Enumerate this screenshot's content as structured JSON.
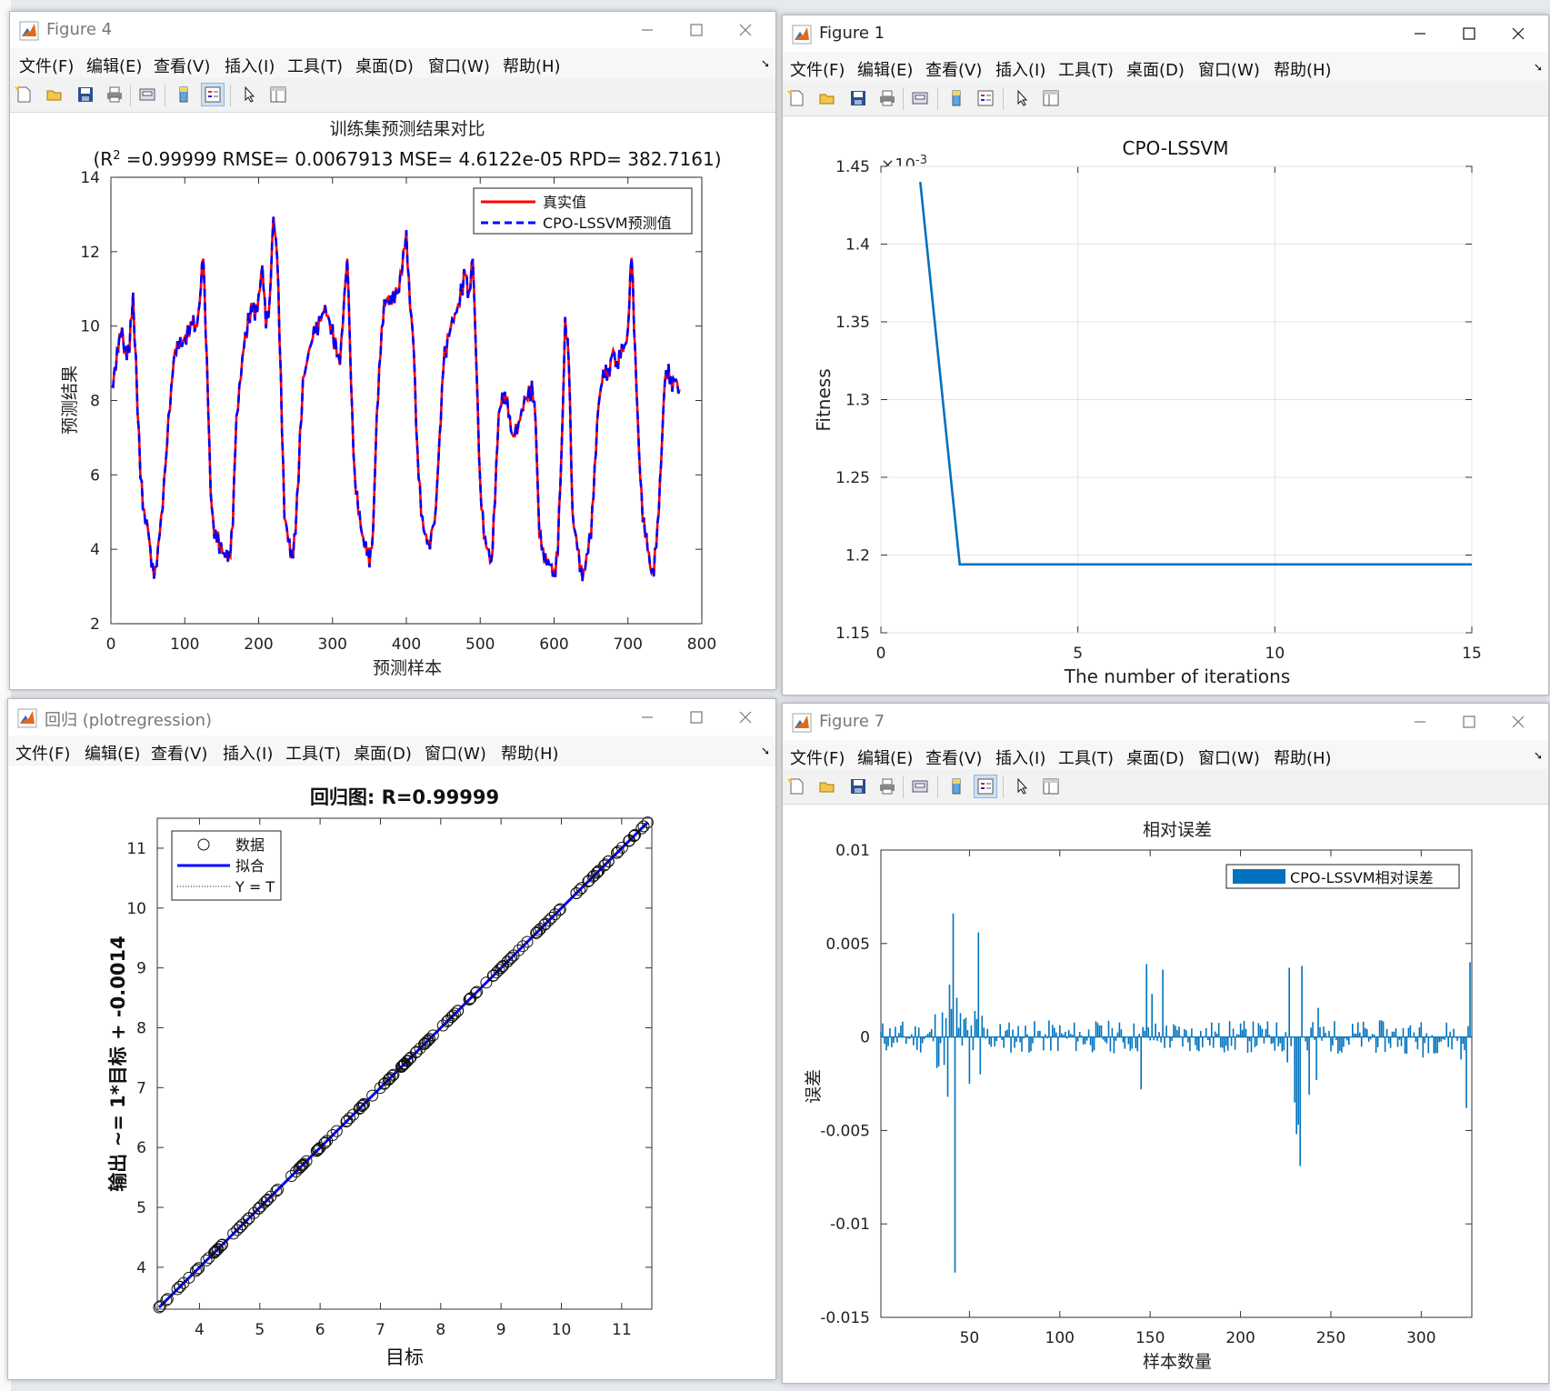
{
  "menu": [
    "文件(F)",
    "编辑(E)",
    "查看(V)",
    "插入(I)",
    "工具(T)",
    "桌面(D)",
    "窗口(W)",
    "帮助(H)"
  ],
  "windows": {
    "fig4": {
      "title": "Figure 4"
    },
    "fig1": {
      "title": "Figure 1"
    },
    "reg": {
      "title": "回归 (plotregression)"
    },
    "fig7": {
      "title": "Figure 7"
    }
  },
  "colors": {
    "true_line": "#ff0000",
    "pred_line": "#0000ff",
    "fitness_line": "#0072bd",
    "error_bars": "#0072bd",
    "fit_line": "#0000ff"
  },
  "chart_data": [
    {
      "id": "pred",
      "type": "line",
      "title": "训练集预测结果对比",
      "subtitle_prefix": "(R",
      "subtitle_sup": "2",
      "subtitle_rest": " =0.99999 RMSE= 0.0067913 MSE= 4.6122e-05 RPD= 382.7161)",
      "xlabel": "预测样本",
      "ylabel": "预测结果",
      "xlim": [
        0,
        800
      ],
      "ylim": [
        2,
        14
      ],
      "xticks": [
        0,
        100,
        200,
        300,
        400,
        500,
        600,
        700,
        800
      ],
      "yticks": [
        2,
        4,
        6,
        8,
        10,
        12,
        14
      ],
      "grid": false,
      "legend_position": "top-right",
      "series": [
        {
          "name": "真实值",
          "style": "solid"
        },
        {
          "name": "CPO-LSSVM预测值",
          "style": "dashed"
        }
      ],
      "x": [
        1,
        5,
        10,
        15,
        18,
        25,
        30,
        40,
        45,
        50,
        55,
        60,
        70,
        80,
        85,
        90,
        100,
        110,
        115,
        120,
        125,
        130,
        135,
        140,
        145,
        155,
        160,
        165,
        170,
        180,
        190,
        195,
        200,
        205,
        210,
        215,
        220,
        225,
        230,
        235,
        240,
        245,
        250,
        260,
        270,
        275,
        280,
        290,
        300,
        310,
        320,
        325,
        330,
        335,
        340,
        345,
        350,
        355,
        360,
        365,
        370,
        375,
        380,
        390,
        400,
        405,
        410,
        415,
        420,
        425,
        430,
        440,
        445,
        450,
        460,
        470,
        480,
        485,
        490,
        495,
        500,
        505,
        510,
        515,
        520,
        525,
        530,
        535,
        540,
        545,
        550,
        560,
        570,
        575,
        580,
        585,
        590,
        595,
        600,
        605,
        610,
        615,
        620,
        625,
        630,
        635,
        640,
        650,
        655,
        660,
        665,
        670,
        675,
        680,
        685,
        690,
        695,
        700,
        705,
        710,
        715,
        720,
        725,
        730,
        735,
        740,
        745,
        750,
        755,
        760,
        765,
        770
      ],
      "values": [
        8.3,
        8.7,
        9.6,
        9.8,
        9.3,
        9.4,
        10.8,
        6.0,
        5.0,
        4.5,
        3.7,
        3.3,
        5.2,
        8.0,
        9.0,
        9.5,
        9.6,
        10.1,
        10.0,
        10.5,
        12.0,
        9.0,
        5.5,
        4.5,
        4.2,
        3.8,
        3.7,
        4.8,
        7.5,
        9.5,
        10.5,
        10.3,
        10.8,
        11.5,
        10.2,
        10.5,
        13.0,
        12.0,
        8.5,
        5.0,
        4.2,
        3.8,
        4.5,
        8.5,
        9.5,
        9.8,
        10.0,
        10.5,
        9.8,
        9.0,
        11.9,
        8.5,
        6.0,
        5.0,
        4.5,
        4.0,
        3.7,
        4.5,
        7.5,
        9.5,
        10.5,
        10.8,
        10.7,
        11.0,
        12.5,
        10.5,
        9.5,
        6.5,
        5.0,
        4.5,
        4.0,
        5.0,
        7.0,
        9.0,
        10.0,
        10.5,
        11.5,
        10.8,
        11.8,
        9.0,
        5.5,
        4.5,
        4.0,
        3.5,
        5.5,
        7.5,
        8.2,
        8.0,
        7.5,
        7.0,
        7.2,
        8.0,
        8.3,
        7.5,
        4.5,
        3.8,
        3.8,
        3.5,
        3.3,
        4.0,
        6.5,
        10.2,
        9.0,
        5.0,
        4.2,
        3.6,
        3.3,
        4.5,
        6.0,
        8.0,
        8.5,
        8.8,
        8.8,
        9.3,
        9.0,
        9.2,
        9.5,
        9.8,
        12.0,
        9.2,
        6.5,
        5.0,
        4.2,
        3.6,
        3.4,
        4.5,
        6.5,
        8.5,
        8.9,
        8.3,
        8.6,
        8.3
      ]
    },
    {
      "id": "fitness",
      "type": "line",
      "title": "CPO-LSSVM",
      "xlabel": "The number of iterations",
      "ylabel": "Fitness",
      "exponent_base": "×10",
      "exponent_power": "-3",
      "xlim": [
        0,
        15
      ],
      "ylim": [
        1.15,
        1.45
      ],
      "xticks": [
        0,
        5,
        10,
        15
      ],
      "yticks": [
        1.15,
        1.2,
        1.25,
        1.3,
        1.35,
        1.4,
        1.45
      ],
      "ytick_labels": [
        "1.15",
        "1.2",
        "1.25",
        "1.3",
        "1.35",
        "1.4",
        "1.45"
      ],
      "grid": true,
      "x": [
        1,
        2,
        3,
        15
      ],
      "values": [
        1.44,
        1.194,
        1.194,
        1.194
      ]
    },
    {
      "id": "regression",
      "type": "scatter",
      "title": "回归图: R=0.99999",
      "xlabel": "目标",
      "ylabel": "输出 ~= 1*目标 + -0.0014",
      "xlim": [
        3.3,
        11.5
      ],
      "ylim": [
        3.3,
        11.5
      ],
      "xticks": [
        4,
        5,
        6,
        7,
        8,
        9,
        10,
        11
      ],
      "yticks": [
        4,
        5,
        6,
        7,
        8,
        9,
        10,
        11
      ],
      "grid": false,
      "legend_position": "top-left",
      "series": [
        {
          "name": "数据",
          "marker": "circle"
        },
        {
          "name": "拟合",
          "style": "solid"
        },
        {
          "name": "Y = T",
          "style": "dotted"
        }
      ],
      "fit": {
        "slope": 1,
        "intercept": -0.0014
      },
      "range": [
        3.33,
        11.43
      ]
    },
    {
      "id": "relerr",
      "type": "bar",
      "title": "相对误差",
      "xlabel": "样本数量",
      "ylabel": "误差",
      "xlim": [
        1,
        328
      ],
      "ylim": [
        -0.015,
        0.01
      ],
      "xticks": [
        50,
        100,
        150,
        200,
        250,
        300
      ],
      "yticks": [
        -0.015,
        -0.01,
        -0.005,
        0,
        0.005,
        0.01
      ],
      "ytick_labels": [
        "-0.015",
        "-0.01",
        "-0.005",
        "0",
        "0.005",
        "0.01"
      ],
      "grid": false,
      "legend_position": "top-right",
      "series": [
        {
          "name": "CPO-LSSVM相对误差"
        }
      ],
      "highlights": [
        {
          "x": 38,
          "value": -0.0032
        },
        {
          "x": 39,
          "value": 0.0028
        },
        {
          "x": 40,
          "value": 0.0015
        },
        {
          "x": 41,
          "value": 0.0066
        },
        {
          "x": 42,
          "value": -0.0126
        },
        {
          "x": 43,
          "value": 0.0021
        },
        {
          "x": 50,
          "value": -0.0025
        },
        {
          "x": 55,
          "value": 0.0056
        },
        {
          "x": 56,
          "value": -0.002
        },
        {
          "x": 145,
          "value": -0.0028
        },
        {
          "x": 148,
          "value": 0.0039
        },
        {
          "x": 151,
          "value": 0.0023
        },
        {
          "x": 157,
          "value": 0.0036
        },
        {
          "x": 227,
          "value": 0.0037
        },
        {
          "x": 230,
          "value": -0.0035
        },
        {
          "x": 231,
          "value": -0.0052
        },
        {
          "x": 232,
          "value": -0.0047
        },
        {
          "x": 233,
          "value": -0.0069
        },
        {
          "x": 234,
          "value": 0.0038
        },
        {
          "x": 238,
          "value": -0.0031
        },
        {
          "x": 242,
          "value": -0.0023
        },
        {
          "x": 301,
          "value": -0.0011
        },
        {
          "x": 322,
          "value": -0.0012
        },
        {
          "x": 325,
          "value": -0.0038
        },
        {
          "x": 327,
          "value": 0.004
        }
      ]
    }
  ]
}
